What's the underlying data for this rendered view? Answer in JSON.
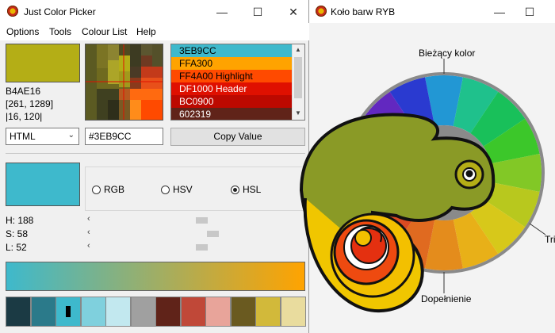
{
  "picker": {
    "title": "Just Color Picker",
    "menu": [
      "Options",
      "Tools",
      "Colour List",
      "Help"
    ],
    "current_hex": "B4AE16",
    "coords1": "[261, 1289]",
    "coords2": "|16, 120|",
    "list": [
      {
        "text": "3EB9CC",
        "bg": "#3eb9cc",
        "fg": "#000000"
      },
      {
        "text": "FFA300",
        "bg": "#ffa300",
        "fg": "#000000"
      },
      {
        "text": "FF4A00 Highlight",
        "bg": "#ff4a00",
        "fg": "#000000"
      },
      {
        "text": "DF1000 Header",
        "bg": "#df1000",
        "fg": "#ffffff"
      },
      {
        "text": "BC0900",
        "bg": "#bc0900",
        "fg": "#ffffff"
      },
      {
        "text": "602319",
        "bg": "#602319",
        "fg": "#ffffff"
      }
    ],
    "format": "HTML",
    "hex_input": "#3EB9CC",
    "copy_label": "Copy Value",
    "modes": {
      "rgb": "RGB",
      "hsv": "HSV",
      "hsl": "HSL",
      "selected": "HSL"
    },
    "h_label": "H: 188",
    "s_label": "S: 58",
    "l_label": "L: 52",
    "h_level": 0.52,
    "s_level": 0.58,
    "l_level": 0.52,
    "current_color": "#b4ae16",
    "selected_color": "#3eb9cc",
    "gradient": [
      "#3eb9cc",
      "#ffa300"
    ],
    "swatches": [
      "#1b3a44",
      "#2b7a8a",
      "#3eb9cc",
      "#7fd0dd",
      "#c2e8ef",
      "#a0a0a0",
      "#602319",
      "#c04838",
      "#e8a49a",
      "#6a5a20",
      "#d2b93a",
      "#e9dc9e"
    ]
  },
  "wheel": {
    "title": "Koło barw RYB",
    "label_current": "Bieżący kolor",
    "label_complement": "Dopełnienie",
    "label_triad": "Tri"
  }
}
